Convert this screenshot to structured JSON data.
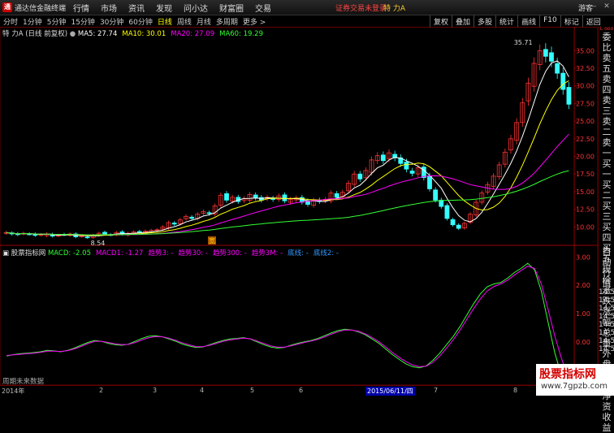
{
  "app": {
    "logo": "通",
    "title": "通达信金融终端",
    "menu": [
      "行情",
      "市场",
      "资讯",
      "发现",
      "问小达",
      "财富圈",
      "交易"
    ],
    "login_status": "证券交易未登录",
    "stock_name": "特 力A",
    "guest": "游客",
    "window_controls": [
      "▢",
      "—",
      "✕"
    ]
  },
  "toolbar": {
    "periods": [
      "分时",
      "1分钟",
      "5分钟",
      "15分钟",
      "30分钟",
      "60分钟",
      "日线",
      "周线",
      "月线",
      "多周期",
      "更多 >"
    ],
    "active_period": "日线",
    "right_tools": [
      "复权",
      "叠加",
      "多股",
      "统计",
      "画线",
      "F10",
      "标记",
      "返回"
    ]
  },
  "main_legend": {
    "title": "特 力A (日线 前复权)",
    "items": [
      {
        "label": "MA5: 27.74",
        "color": "#ffffff"
      },
      {
        "label": "MA10: 30.01",
        "color": "#ffff00"
      },
      {
        "label": "MA20: 27.09",
        "color": "#ff00ff"
      },
      {
        "label": "MA60: 19.29",
        "color": "#33ff33"
      }
    ]
  },
  "sub_legend": {
    "title": "股票指标网",
    "items": [
      {
        "label": "MACD: -2.05",
        "color": "#33ff33"
      },
      {
        "label": "MACD1: -1.27",
        "color": "#ff00ff"
      },
      {
        "label": "趋势3: -",
        "color": "#ff00ff"
      },
      {
        "label": "趋势30: -",
        "color": "#ff00ff"
      },
      {
        "label": "趋势300: -",
        "color": "#ff00ff"
      },
      {
        "label": "趋势3M: -",
        "color": "#ff00ff"
      },
      {
        "label": "底线: -",
        "color": "#3399ff"
      },
      {
        "label": "底线2: -",
        "color": "#3399ff"
      }
    ]
  },
  "price_axis": [
    "35.00",
    "32.50",
    "30.00",
    "27.50",
    "25.00",
    "22.50",
    "20.00",
    "17.50",
    "15.00",
    "12.50",
    "10.00"
  ],
  "macd_axis": [
    "3.00",
    "2.00",
    "1.00",
    "0.00",
    "-1.00"
  ],
  "annotations": {
    "high_label": "35.71",
    "low_label": "8.54",
    "marker": "宽"
  },
  "sidebar_top": [
    "L",
    "ooo"
  ],
  "sidebar_main": [
    "委比",
    "卖五",
    "卖四",
    "卖三",
    "卖二",
    "卖一",
    "买一",
    "买二",
    "买三",
    "买四",
    "买五",
    "现价",
    "涨跌",
    "涨幅",
    "总量",
    "外盘",
    "换手",
    "净资",
    "收益"
  ],
  "sidebar_sub": [
    "自动",
    "行情",
    "14:5(",
    "14:5(",
    "14:5(",
    "14:5(",
    "14:5(",
    "14:5(",
    "14:5(",
    "14:5("
  ],
  "time_axis": [
    "2014年",
    "2",
    "3",
    "4",
    "5",
    "6",
    "2015/06/11/四",
    "7",
    "8"
  ],
  "nodata": "周期未来数据",
  "watermark": {
    "big": "股票指标网",
    "small": "www.7gpzb.com"
  },
  "chart_data": [
    {
      "type": "candlestick",
      "title": "特 力A (日线 前复权)",
      "ylim": [
        7.5,
        37
      ],
      "yticks": [
        10,
        12.5,
        15,
        17.5,
        20,
        22.5,
        25,
        27.5,
        30,
        32.5,
        35
      ],
      "close": [
        9.2,
        9.0,
        8.9,
        9.1,
        9.0,
        8.8,
        8.9,
        9.0,
        8.7,
        8.8,
        8.9,
        9.0,
        8.6,
        8.7,
        8.54,
        8.8,
        9.1,
        9.0,
        8.9,
        9.2,
        9.0,
        9.1,
        9.3,
        9.2,
        9.4,
        9.5,
        9.6,
        10.0,
        10.6,
        10.4,
        11.0,
        11.5,
        11.2,
        11.8,
        12.2,
        11.9,
        13.0,
        14.5,
        13.8,
        14.2,
        13.6,
        14.0,
        14.6,
        14.1,
        13.8,
        14.2,
        13.9,
        14.4,
        13.7,
        13.9,
        14.1,
        13.5,
        13.2,
        13.8,
        13.6,
        13.9,
        14.8,
        14.2,
        14.9,
        16.2,
        17.5,
        16.8,
        18.0,
        19.5,
        20.1,
        19.4,
        20.5,
        19.8,
        19.0,
        18.2,
        17.6,
        18.4,
        17.0,
        15.4,
        13.8,
        12.9,
        11.2,
        10.3,
        9.8,
        10.5,
        11.8,
        13.5,
        14.8,
        16.0,
        17.2,
        18.8,
        20.6,
        22.5,
        24.8,
        27.6,
        30.4,
        33.2,
        35.0,
        34.2,
        33.5,
        31.8,
        29.5,
        27.4
      ],
      "series": [
        {
          "name": "MA5",
          "value_now": 27.74
        },
        {
          "name": "MA10",
          "value_now": 30.01
        },
        {
          "name": "MA20",
          "value_now": 27.09
        },
        {
          "name": "MA60",
          "value_now": 19.29
        }
      ]
    },
    {
      "type": "line",
      "title": "股票指标网",
      "ylim": [
        -1.5,
        3.3
      ],
      "yticks": [
        -1,
        0,
        1,
        2,
        3
      ],
      "series": [
        {
          "name": "MACD",
          "color": "#33ff33",
          "values": [
            -0.5,
            -0.45,
            -0.42,
            -0.4,
            -0.38,
            -0.35,
            -0.3,
            -0.32,
            -0.35,
            -0.3,
            -0.22,
            -0.12,
            -0.02,
            0.05,
            0.02,
            -0.05,
            -0.1,
            -0.12,
            -0.08,
            0.02,
            0.12,
            0.2,
            0.22,
            0.18,
            0.1,
            0.02,
            -0.08,
            -0.15,
            -0.2,
            -0.18,
            -0.1,
            -0.02,
            0.05,
            0.1,
            0.12,
            0.15,
            0.1,
            0.0,
            -0.1,
            -0.18,
            -0.22,
            -0.2,
            -0.12,
            -0.05,
            0.0,
            0.05,
            0.12,
            0.22,
            0.32,
            0.4,
            0.45,
            0.42,
            0.35,
            0.25,
            0.1,
            -0.05,
            -0.25,
            -0.45,
            -0.62,
            -0.78,
            -0.88,
            -0.92,
            -0.85,
            -0.65,
            -0.4,
            -0.1,
            0.2,
            0.55,
            0.95,
            1.35,
            1.7,
            1.95,
            2.05,
            2.1,
            2.25,
            2.45,
            2.6,
            2.78,
            2.55,
            1.8,
            0.7,
            -0.4,
            -1.2,
            -2.05
          ]
        },
        {
          "name": "MACD1",
          "color": "#ff00ff",
          "values": [
            -0.48,
            -0.46,
            -0.44,
            -0.42,
            -0.4,
            -0.37,
            -0.33,
            -0.33,
            -0.34,
            -0.31,
            -0.25,
            -0.16,
            -0.06,
            0.02,
            0.02,
            -0.02,
            -0.07,
            -0.1,
            -0.09,
            -0.02,
            0.07,
            0.15,
            0.19,
            0.18,
            0.13,
            0.05,
            -0.04,
            -0.11,
            -0.17,
            -0.17,
            -0.12,
            -0.05,
            0.02,
            0.07,
            0.1,
            0.13,
            0.11,
            0.03,
            -0.06,
            -0.14,
            -0.19,
            -0.19,
            -0.14,
            -0.08,
            -0.02,
            0.03,
            0.09,
            0.18,
            0.28,
            0.36,
            0.42,
            0.42,
            0.37,
            0.28,
            0.15,
            0.0,
            -0.18,
            -0.38,
            -0.55,
            -0.7,
            -0.82,
            -0.88,
            -0.86,
            -0.72,
            -0.5,
            -0.22,
            0.08,
            0.42,
            0.8,
            1.18,
            1.52,
            1.8,
            1.96,
            2.05,
            2.18,
            2.36,
            2.52,
            2.68,
            2.6,
            2.05,
            1.15,
            0.2,
            -0.6,
            -1.27
          ]
        }
      ]
    }
  ]
}
